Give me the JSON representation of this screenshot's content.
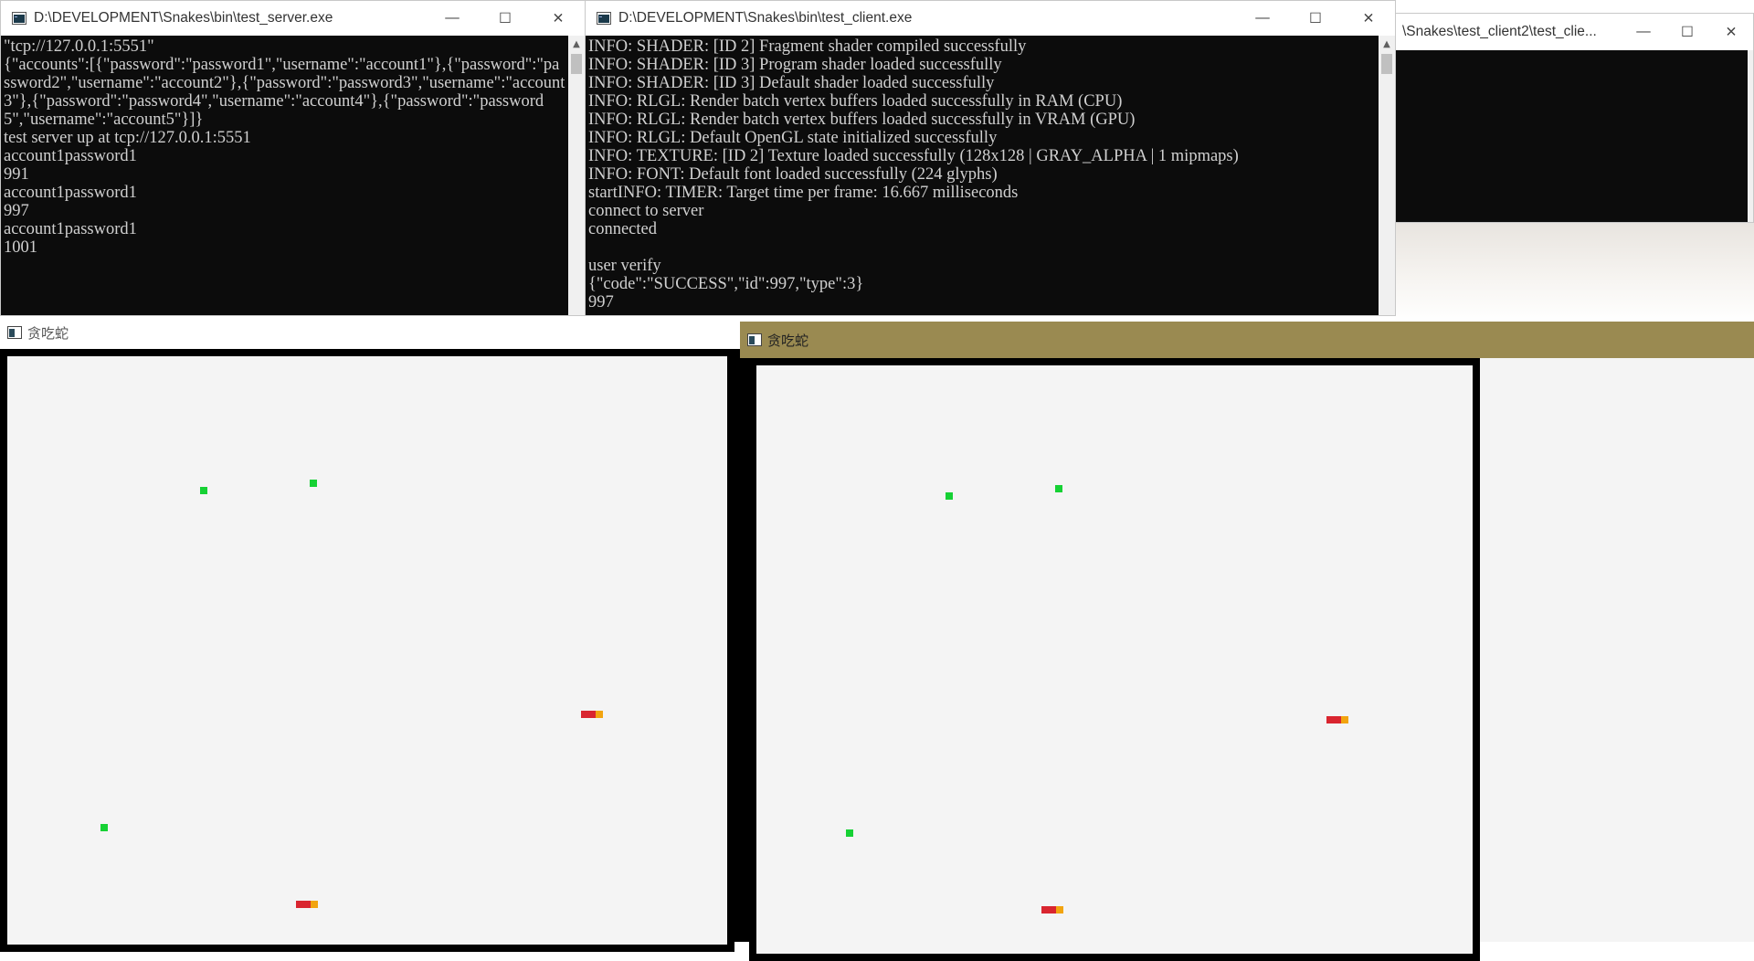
{
  "server_window": {
    "title": "D:\\DEVELOPMENT\\Snakes\\bin\\test_server.exe",
    "icon": "console-app-icon",
    "controls": {
      "minimize": "—",
      "maximize": "☐",
      "close": "✕"
    },
    "lines": [
      "\"tcp://127.0.0.1:5551\"",
      "{\"accounts\":[{\"password\":\"password1\",\"username\":\"account1\"},{\"password\":\"password2\",\"username\":\"account2\"},{\"password\":\"password3\",\"username\":\"account3\"},{\"password\":\"password4\",\"username\":\"account4\"},{\"password\":\"password5\",\"username\":\"account5\"}]}",
      "test server up at tcp://127.0.0.1:5551",
      "account1password1",
      "991",
      "account1password1",
      "997",
      "account1password1",
      "1001"
    ]
  },
  "client_window": {
    "title": "D:\\DEVELOPMENT\\Snakes\\bin\\test_client.exe",
    "icon": "console-app-icon",
    "controls": {
      "minimize": "—",
      "maximize": "☐",
      "close": "✕"
    },
    "lines": [
      "INFO: SHADER: [ID 2] Fragment shader compiled successfully",
      "INFO: SHADER: [ID 3] Program shader loaded successfully",
      "INFO: SHADER: [ID 3] Default shader loaded successfully",
      "INFO: RLGL: Render batch vertex buffers loaded successfully in RAM (CPU)",
      "INFO: RLGL: Render batch vertex buffers loaded successfully in VRAM (GPU)",
      "INFO: RLGL: Default OpenGL state initialized successfully",
      "INFO: TEXTURE: [ID 2] Texture loaded successfully (128x128 | GRAY_ALPHA | 1 mipmaps)",
      "INFO: FONT: Default font loaded successfully (224 glyphs)",
      "startINFO: TIMER: Target time per frame: 16.667 milliseconds",
      "connect to server",
      "connected",
      "",
      "user verify",
      "{\"code\":\"SUCCESS\",\"id\":997,\"type\":3}",
      "997"
    ]
  },
  "client2_window": {
    "title": "\\Snakes\\test_client2\\test_clie...",
    "controls": {
      "minimize": "—",
      "maximize": "☐",
      "close": "✕"
    }
  },
  "game_left": {
    "title": "贪吃蛇",
    "icon": "game-window-icon",
    "field_color": "#f4f4f4",
    "pellet_color": "#16d134",
    "snake_body_color": "#d9252f",
    "snake_head_color": "#f2a40f",
    "pellets": 3,
    "snakes": 2
  },
  "game_right": {
    "title": "贪吃蛇",
    "icon": "game-window-icon",
    "titlebar_color": "#9a8a51",
    "pellets": 3,
    "snakes": 2
  }
}
